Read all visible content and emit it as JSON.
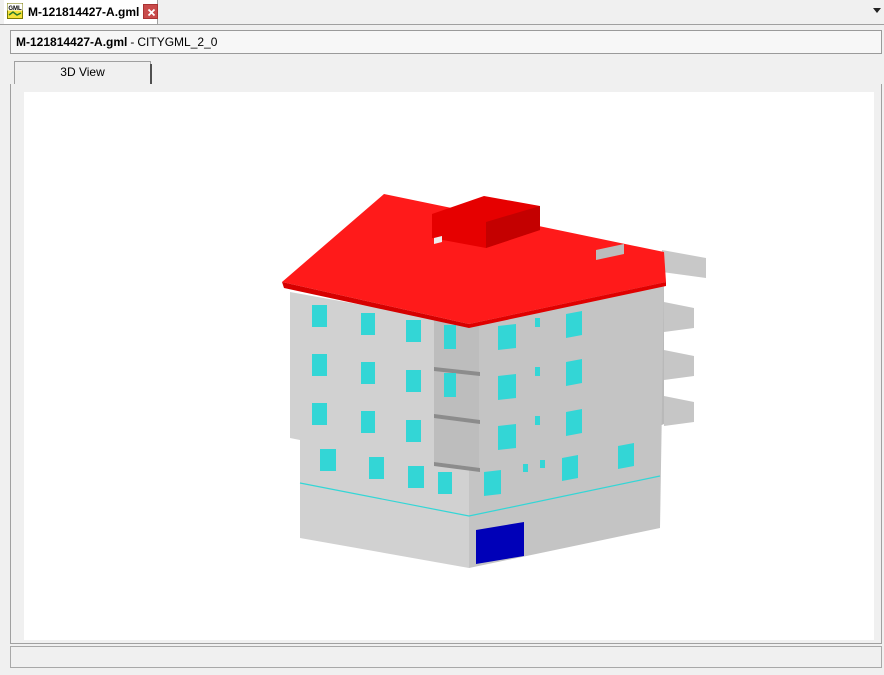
{
  "app": {
    "doc_tab": {
      "label": "M-121814427-A.gml",
      "icon": "gml-file-icon",
      "icon_text": "GML"
    },
    "header": {
      "file_name": "M-121814427-A.gml",
      "separator": "-",
      "format": "CITYGML_2_0"
    },
    "view_tabs": [
      {
        "label": "3D View",
        "selected": true
      }
    ],
    "colors": {
      "roof": "#ff1a1a",
      "wall": "#cfcfcf",
      "window": "#33d6d6",
      "door": "#0000b8",
      "viewport_bg": "#ffffff",
      "chrome_bg": "#f0f0f0"
    }
  }
}
